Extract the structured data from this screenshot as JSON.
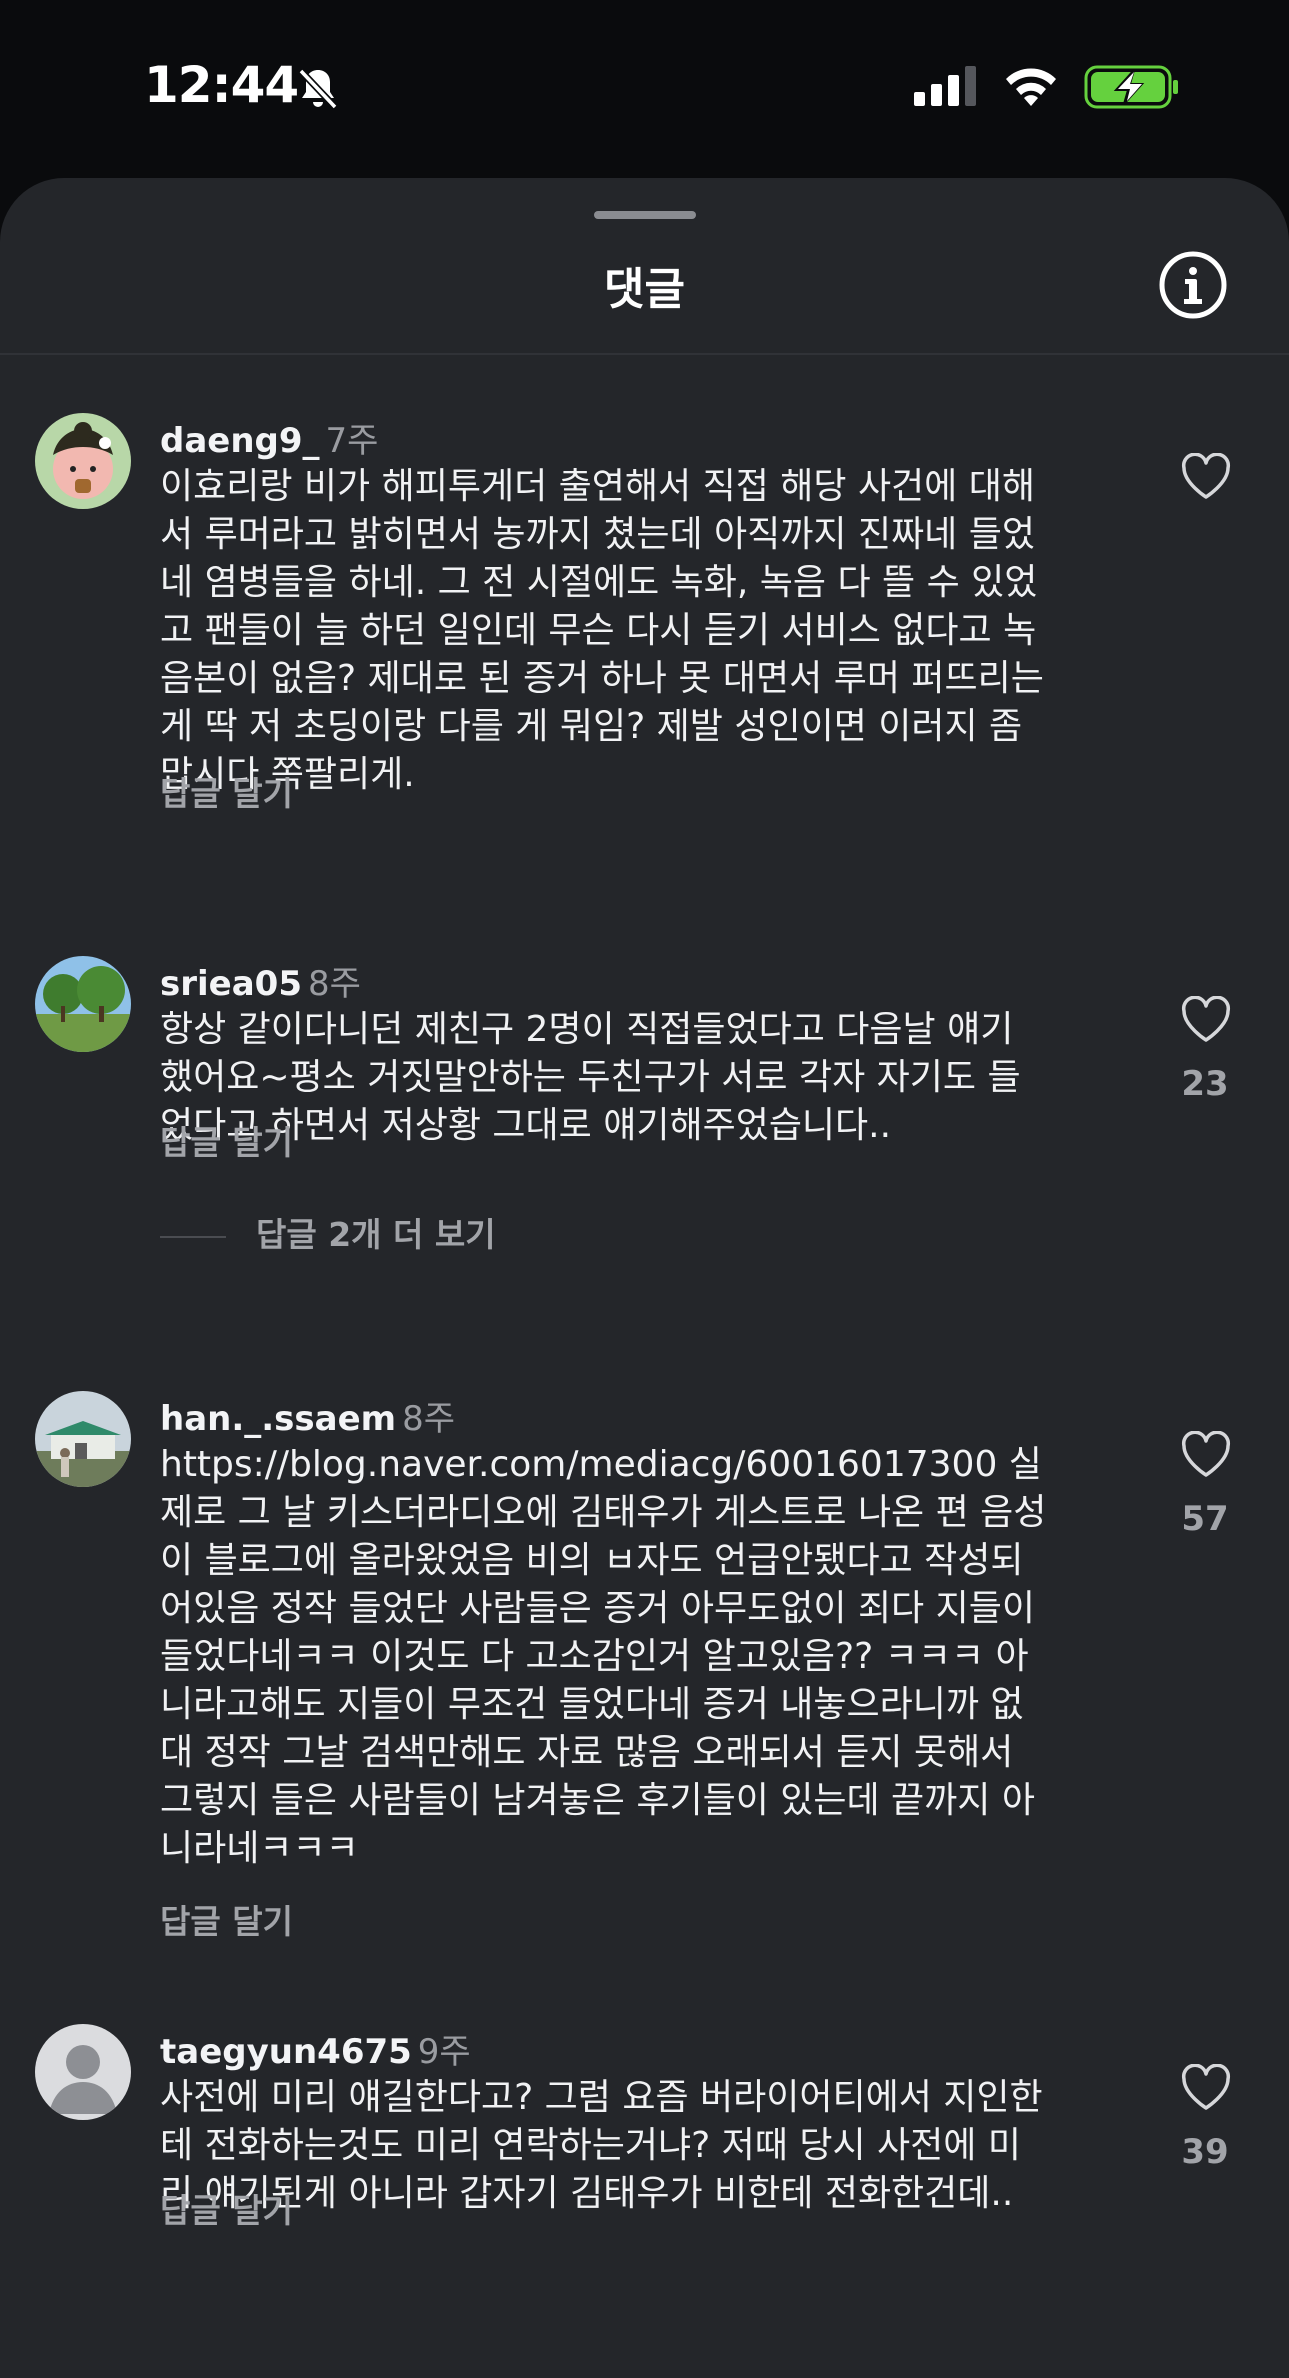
{
  "status_bar": {
    "time": "12:44",
    "icons": [
      "bell-off-icon",
      "cellular-signal-icon",
      "wifi-icon",
      "battery-charging-icon"
    ]
  },
  "sheet": {
    "title": "댓글",
    "info_icon": "info-icon"
  },
  "comments": [
    {
      "username": "daeng9_",
      "age": "7주",
      "text": "이효리랑 비가 해피투게더 출연해서 직접 해당 사건에 대해\n서 루머라고 밝히면서 농까지 쳤는데 아직까지 진짜네 들었\n네 염병들을 하네. 그 전 시절에도 녹화, 녹음 다 뜰 수 있었\n고 팬들이 늘 하던 일인데 무슨 다시 듣기 서비스 없다고 녹\n음본이 없음? 제대로 된 증거 하나 못 대면서 루머 퍼뜨리는\n게 딱 저 초딩이랑 다를 게 뭐임? 제발 성인이면 이러지 좀\n맙시다 쪽팔리게.",
      "reply_label": "답글 달기",
      "likes": ""
    },
    {
      "username": "sriea05",
      "age": "8주",
      "text": "항상 같이다니던 제친구 2명이 직접들었다고 다음날 얘기\n했어요~평소 거짓말안하는 두친구가 서로 각자 자기도 들\n었다고 하면서 저상황 그대로 얘기해주었습니다..",
      "reply_label": "답글 달기",
      "likes": "23",
      "more_replies": "답글 2개 더 보기"
    },
    {
      "username": "han._.ssaem",
      "age": "8주",
      "text": "https://blog.naver.com/mediacg/60016017300  실\n제로 그 날 키스더라디오에 김태우가 게스트로 나온 편 음성\n이 블로그에 올라왔었음 비의 ㅂ자도 언급안됐다고 작성되\n어있음 정작 들었단 사람들은 증거 아무도없이 죄다 지들이\n들었다네ㅋㅋ 이것도 다 고소감인거 알고있음?? ㅋㅋㅋ 아\n니라고해도 지들이 무조건 들었다네 증거 내놓으라니까 없\n대 정작 그날 검색만해도 자료 많음 오래되서 듣지 못해서\n그렇지 들은 사람들이 남겨놓은 후기들이 있는데 끝까지 아\n니라네ㅋㅋㅋ",
      "reply_label": "답글 달기",
      "likes": "57"
    },
    {
      "username": "taegyun4675",
      "age": "9주",
      "text": "사전에 미리 얘길한다고? 그럼 요즘 버라이어티에서 지인한\n테 전화하는것도 미리 연락하는거냐? 저때 당시 사전에 미\n리 얘기된게 아니라 갑자기 김태우가 비한테 전화한건데..",
      "reply_label": "답글 달기",
      "likes": "39"
    }
  ],
  "colors": {
    "sheet_background": "#24262a",
    "status_background": "#0a0b0d",
    "primary_text": "#f1f2f4",
    "secondary_text": "#a2a4a9",
    "battery_green": "#65d13e"
  }
}
